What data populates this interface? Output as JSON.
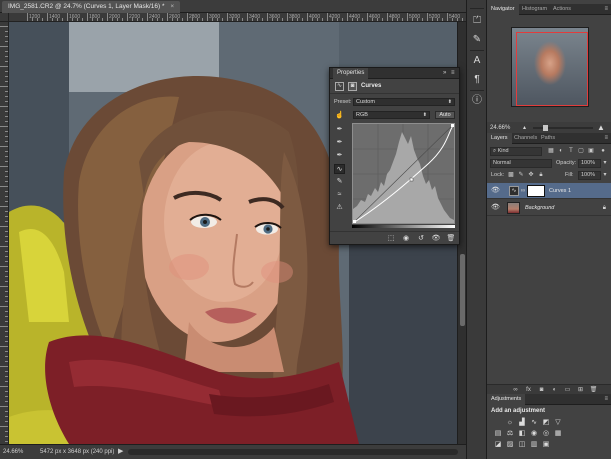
{
  "document": {
    "tab_title": "IMG_2581.CR2 @ 24.7% (Curves 1, Layer Mask/16) *",
    "ruler_marks": [
      "1200",
      "1400",
      "1600",
      "1800",
      "2000",
      "2200",
      "2400",
      "2600",
      "2800",
      "3000",
      "3200",
      "3400",
      "3600",
      "3800",
      "4000",
      "4200",
      "4400",
      "4600",
      "4800",
      "5000",
      "5200",
      "5400"
    ]
  },
  "status": {
    "zoom": "24.66%",
    "doc_size": "5472 px x 3648 px (240 ppi)",
    "arrow": "▶"
  },
  "navigator": {
    "tabs": [
      "Navigator",
      "Histogram",
      "Actions"
    ],
    "zoom": "24.66%"
  },
  "layers": {
    "tabs": [
      "Layers",
      "Channels",
      "Paths"
    ],
    "filter_kind": "Kind",
    "blend_mode": "Normal",
    "opacity_label": "Opacity:",
    "opacity_value": "100%",
    "lock_label": "Lock:",
    "fill_label": "Fill:",
    "fill_value": "100%",
    "items": [
      {
        "name": "Curves 1",
        "selected": true
      },
      {
        "name": "Background",
        "selected": false
      }
    ]
  },
  "adjustments": {
    "tab": "Adjustments",
    "title": "Add an adjustment"
  },
  "properties": {
    "tab": "Properties",
    "type_label": "Curves",
    "preset_label": "Preset:",
    "preset_value": "Custom",
    "channel_value": "RGB",
    "auto_label": "Auto"
  },
  "colors": {
    "accent_selected_layer": "#556b8b",
    "navigator_proxy": "#e23c3c",
    "panel_bg": "#424242"
  },
  "icons": {
    "tool_strip": [
      "history-icon",
      "brush-presets-icon",
      "character-icon",
      "paragraph-icon",
      "info-icon"
    ]
  }
}
